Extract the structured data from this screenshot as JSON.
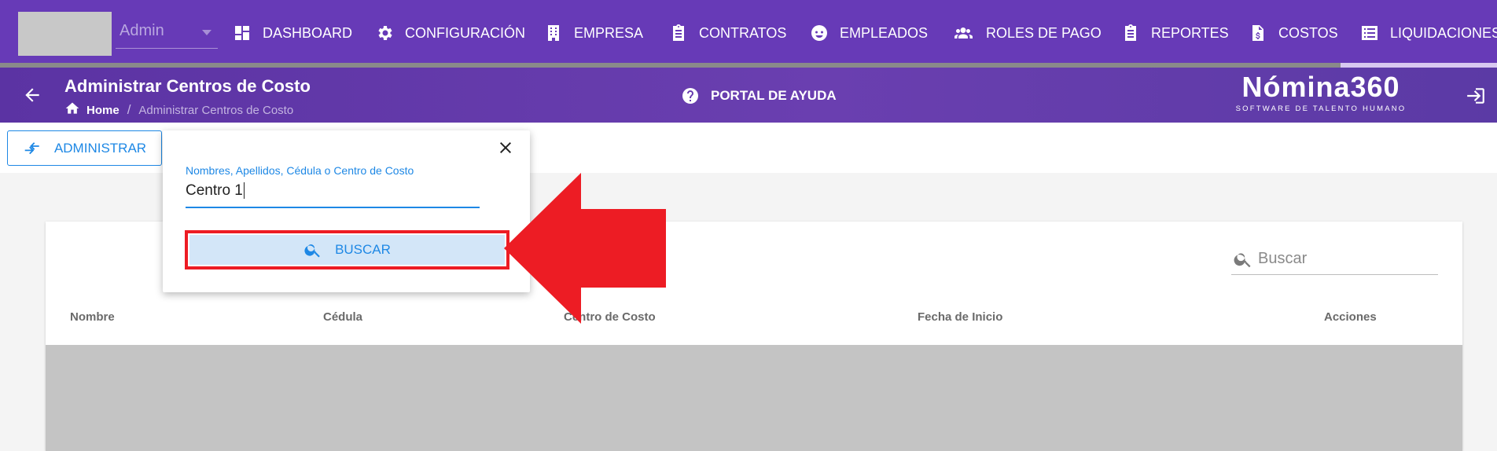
{
  "topnav": {
    "user": "Admin",
    "items": [
      {
        "label": "DASHBOARD",
        "icon": "dashboard-icon"
      },
      {
        "label": "CONFIGURACIÓN",
        "icon": "gear-icon"
      },
      {
        "label": "EMPRESA",
        "icon": "building-icon"
      },
      {
        "label": "CONTRATOS",
        "icon": "clipboard-icon"
      },
      {
        "label": "EMPLEADOS",
        "icon": "face-icon"
      },
      {
        "label": "ROLES DE PAGO",
        "icon": "people-icon"
      },
      {
        "label": "REPORTES",
        "icon": "clipboard-icon"
      },
      {
        "label": "COSTOS",
        "icon": "invoice-icon"
      },
      {
        "label": "LIQUIDACIONES",
        "icon": "list-icon"
      }
    ]
  },
  "header": {
    "title": "Administrar Centros de Costo",
    "breadcrumb": {
      "home": "Home",
      "separator": "/",
      "current": "Administrar Centros de Costo"
    },
    "help": "PORTAL DE AYUDA",
    "brand_name": "Nómina360",
    "brand_tagline": "SOFTWARE DE TALENTO HUMANO"
  },
  "toolbar": {
    "admin_label": "ADMINISTRAR"
  },
  "search_popover": {
    "field_label": "Nombres, Apellidos, Cédula o Centro de Costo",
    "field_value": "Centro 1",
    "button_label": "BUSCAR"
  },
  "table": {
    "search_placeholder": "Buscar",
    "columns": [
      "Nombre",
      "Cédula",
      "Centro de Costo",
      "Fecha de Inicio",
      "Acciones"
    ]
  },
  "colors": {
    "nav_bg": "#673ab7",
    "accent": "#1e88e5",
    "highlight": "#ed1c24"
  }
}
